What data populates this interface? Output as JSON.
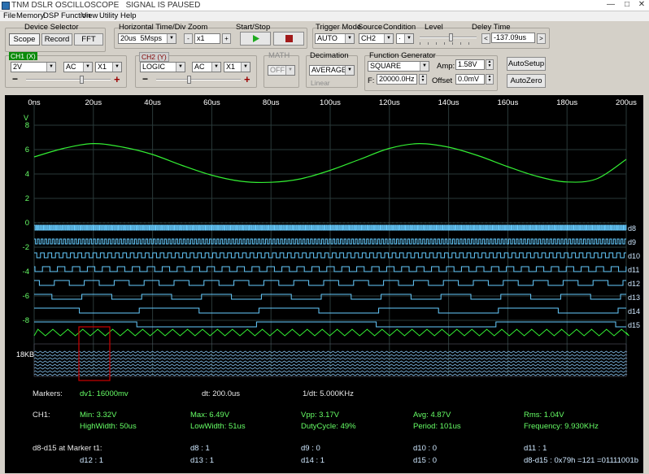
{
  "window": {
    "title": "TNM DSLR OSCILLOSCOPE",
    "status": "SIGNAL IS PAUSED",
    "min": "—",
    "max": "□",
    "close": "✕"
  },
  "menu": [
    "File",
    "Memory",
    "DSP Function",
    "View",
    "Utility",
    "Help"
  ],
  "device_selector": {
    "label": "Device Selector",
    "buttons": [
      "Scope",
      "Record",
      "FFT"
    ],
    "active": "Scope"
  },
  "horizontal": {
    "label": "Horizontal Time/Div",
    "value": "20us",
    "rate": "5Msps"
  },
  "zoom": {
    "label": "Zoom",
    "minus": "-",
    "value": "x1",
    "plus": "+"
  },
  "startstop": {
    "label": "Start/Stop"
  },
  "trigger": {
    "mode_label": "Trigger Mode",
    "mode": "AUTO",
    "source_label": "Source",
    "source": "CH2",
    "condition_label": "Condition",
    "condition": "·",
    "level_label": "Level",
    "delay_label": "Deley Time",
    "delay_value": "-137.09us",
    "delay_prev": "<",
    "delay_next": ">"
  },
  "ch1": {
    "tag": "CH1 (X)",
    "volt": "2V",
    "coupling": "AC",
    "probe": "X1",
    "minus": "−",
    "plus": "+",
    "accent": "#008000"
  },
  "ch2": {
    "tag": "CH2 (Y)",
    "volt": "LOGIC",
    "coupling": "AC",
    "probe": "X1",
    "minus": "−",
    "plus": "+",
    "accent": "#800000"
  },
  "math": {
    "label": "MATH",
    "value": "OFF"
  },
  "decimation": {
    "label": "Decimation",
    "value": "AVERAGE",
    "linear": "Linear"
  },
  "fgen": {
    "label": "Function Generator",
    "wave": "SQUARE",
    "amp_label": "Amp:",
    "amp": "1.58V",
    "f_label": "F:",
    "freq": "20000.0Hz",
    "offset_label": "Offset",
    "offset": "0.0mV"
  },
  "autosetup": "AutoSetup",
  "autozero": "AutoZero",
  "scope": {
    "x_ticks": [
      "0ns",
      "20us",
      "40us",
      "60us",
      "80us",
      "100us",
      "120us",
      "140us",
      "160us",
      "180us",
      "200us"
    ],
    "y_unit": "V",
    "y_ticks": [
      "8",
      "6",
      "4",
      "2",
      "0",
      "-2",
      "-4",
      "-6",
      "-8"
    ],
    "digital_labels": [
      "d8",
      "d9",
      "d10",
      "d11",
      "d12",
      "d13",
      "d14",
      "d15"
    ],
    "memory_label": "18KB",
    "colors": {
      "ch1": "#33ee33",
      "digital": "#66ccff",
      "grid": "#2a3a3a",
      "text": "#ffffff",
      "marker": "#cc0000"
    }
  },
  "chart_data": {
    "type": "line",
    "x_unit": "us",
    "y_unit": "V",
    "xlim": [
      0,
      200
    ],
    "ylim": [
      -8,
      8
    ],
    "series": [
      {
        "name": "CH1",
        "x": [
          0,
          10,
          20,
          30,
          40,
          50,
          60,
          70,
          80,
          90,
          100,
          110,
          120,
          130,
          140,
          150,
          160,
          170,
          180,
          190,
          200
        ],
        "values": [
          5.4,
          6.1,
          6.49,
          6.2,
          5.6,
          4.7,
          3.9,
          3.4,
          3.32,
          3.6,
          4.3,
          5.2,
          6.1,
          6.49,
          6.2,
          5.5,
          4.6,
          3.8,
          3.35,
          3.6,
          5.2
        ]
      }
    ]
  },
  "stats": {
    "markers_label": "Markers:",
    "dv": "dv1: 16000mv",
    "dt": "dt: 200.0us",
    "inv_dt": "1/dt: 5.000KHz",
    "ch_label": "CH1:",
    "min": "Min: 3.32V",
    "max": "Max: 6.49V",
    "vpp": "Vpp: 3.17V",
    "avg": "Avg: 4.87V",
    "rms": "Rms: 1.04V",
    "high_width": "HighWidth: 50us",
    "low_width": "LowWidth: 51us",
    "duty": "DutyCycle: 49%",
    "period": "Period: 101us",
    "freq": "Frequency: 9.930KHz",
    "digital_label": "d8-d15 at Marker t1:",
    "d8": "d8 : 1",
    "d9": "d9 : 0",
    "d10": "d10 : 0",
    "d11": "d11 : 1",
    "d12": "d12 : 1",
    "d13": "d13 : 1",
    "d14": "d14 : 1",
    "d15": "d15 : 0",
    "hex": "d8-d15 : 0x79h =121 =01111001b"
  }
}
